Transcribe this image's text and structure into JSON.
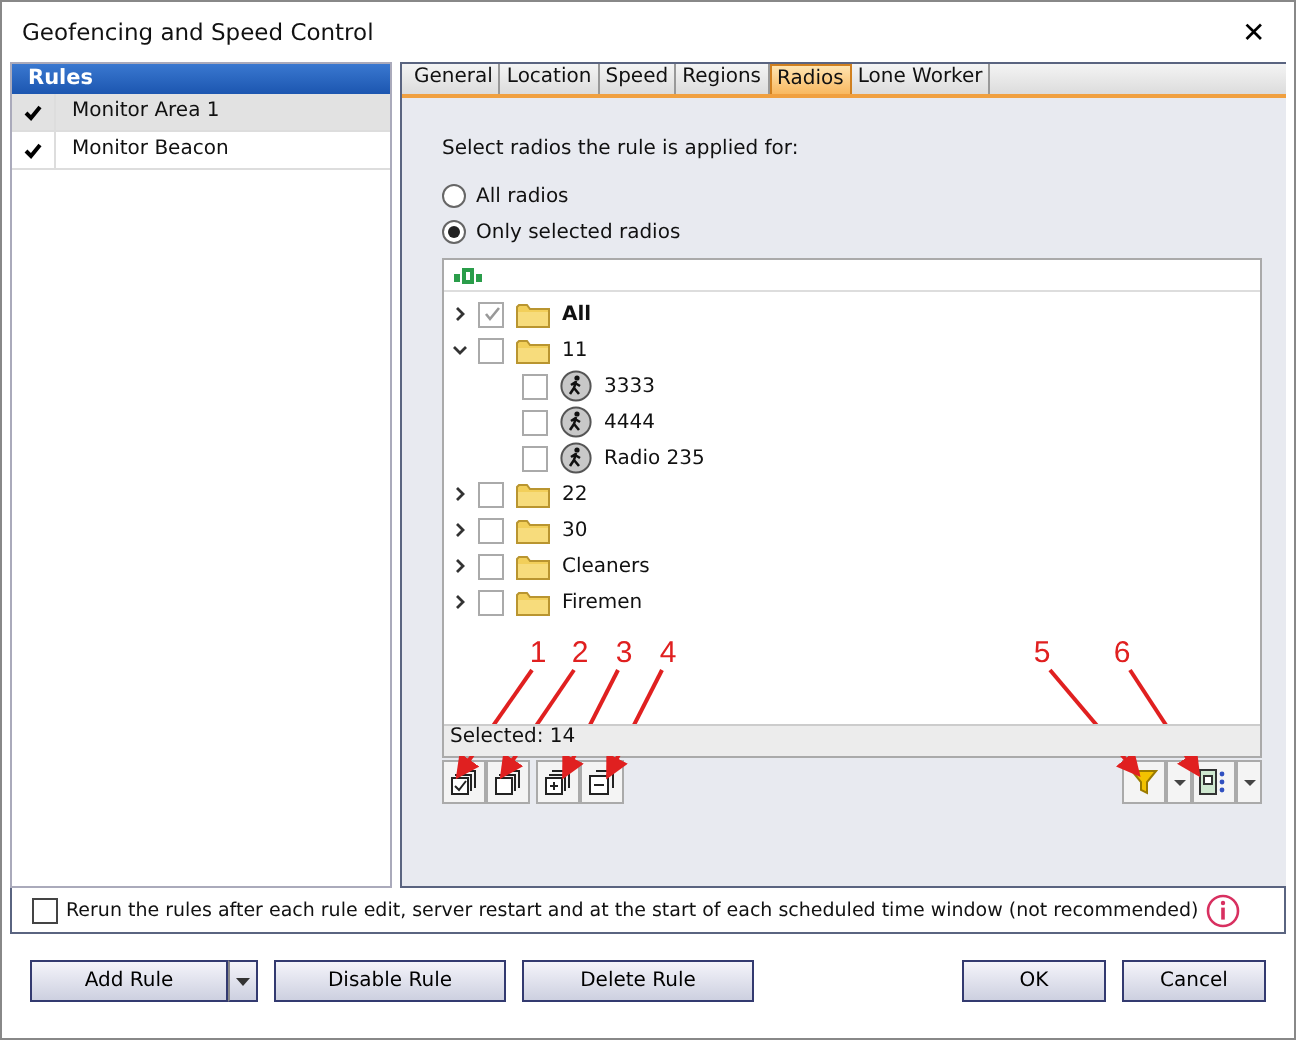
{
  "window": {
    "title": "Geofencing and Speed Control",
    "close": "✕"
  },
  "rules": {
    "header": "Rules",
    "items": [
      {
        "label": "Monitor Area 1",
        "checked": true,
        "selected": true
      },
      {
        "label": "Monitor Beacon",
        "checked": true,
        "selected": false
      }
    ]
  },
  "tabs": [
    {
      "label": "General",
      "selected": false
    },
    {
      "label": "Location",
      "selected": false
    },
    {
      "label": "Speed",
      "selected": false
    },
    {
      "label": "Regions",
      "selected": false
    },
    {
      "label": "Radios",
      "selected": true
    },
    {
      "label": "Lone Worker",
      "selected": false
    }
  ],
  "prompt": "Select radios the rule is applied for:",
  "radio_options": [
    {
      "label": "All radios",
      "selected": false
    },
    {
      "label": "Only selected radios",
      "selected": true
    }
  ],
  "tree": [
    {
      "kind": "folder",
      "label": "All",
      "bold": true,
      "checked": true,
      "expanded": false
    },
    {
      "kind": "folder",
      "label": "11",
      "checked": false,
      "expanded": true,
      "children": [
        {
          "kind": "radio",
          "label": "3333",
          "checked": false
        },
        {
          "kind": "radio",
          "label": "4444",
          "checked": false
        },
        {
          "kind": "radio",
          "label": "Radio 235",
          "checked": false
        }
      ]
    },
    {
      "kind": "folder",
      "label": "22",
      "checked": false,
      "expanded": false
    },
    {
      "kind": "folder",
      "label": "30",
      "checked": false,
      "expanded": false
    },
    {
      "kind": "folder",
      "label": "Cleaners",
      "checked": false,
      "expanded": false
    },
    {
      "kind": "folder",
      "label": "Firemen",
      "checked": false,
      "expanded": false
    }
  ],
  "status": "Selected: 14",
  "callouts": [
    "1",
    "2",
    "3",
    "4",
    "5",
    "6"
  ],
  "rerun": {
    "label": "Rerun the rules after each rule edit, server restart and at the start of each scheduled time window (not recommended)",
    "checked": false
  },
  "buttons": {
    "left": [
      "Add Rule",
      "Disable Rule",
      "Delete Rule"
    ],
    "right": [
      "OK",
      "Cancel"
    ]
  }
}
